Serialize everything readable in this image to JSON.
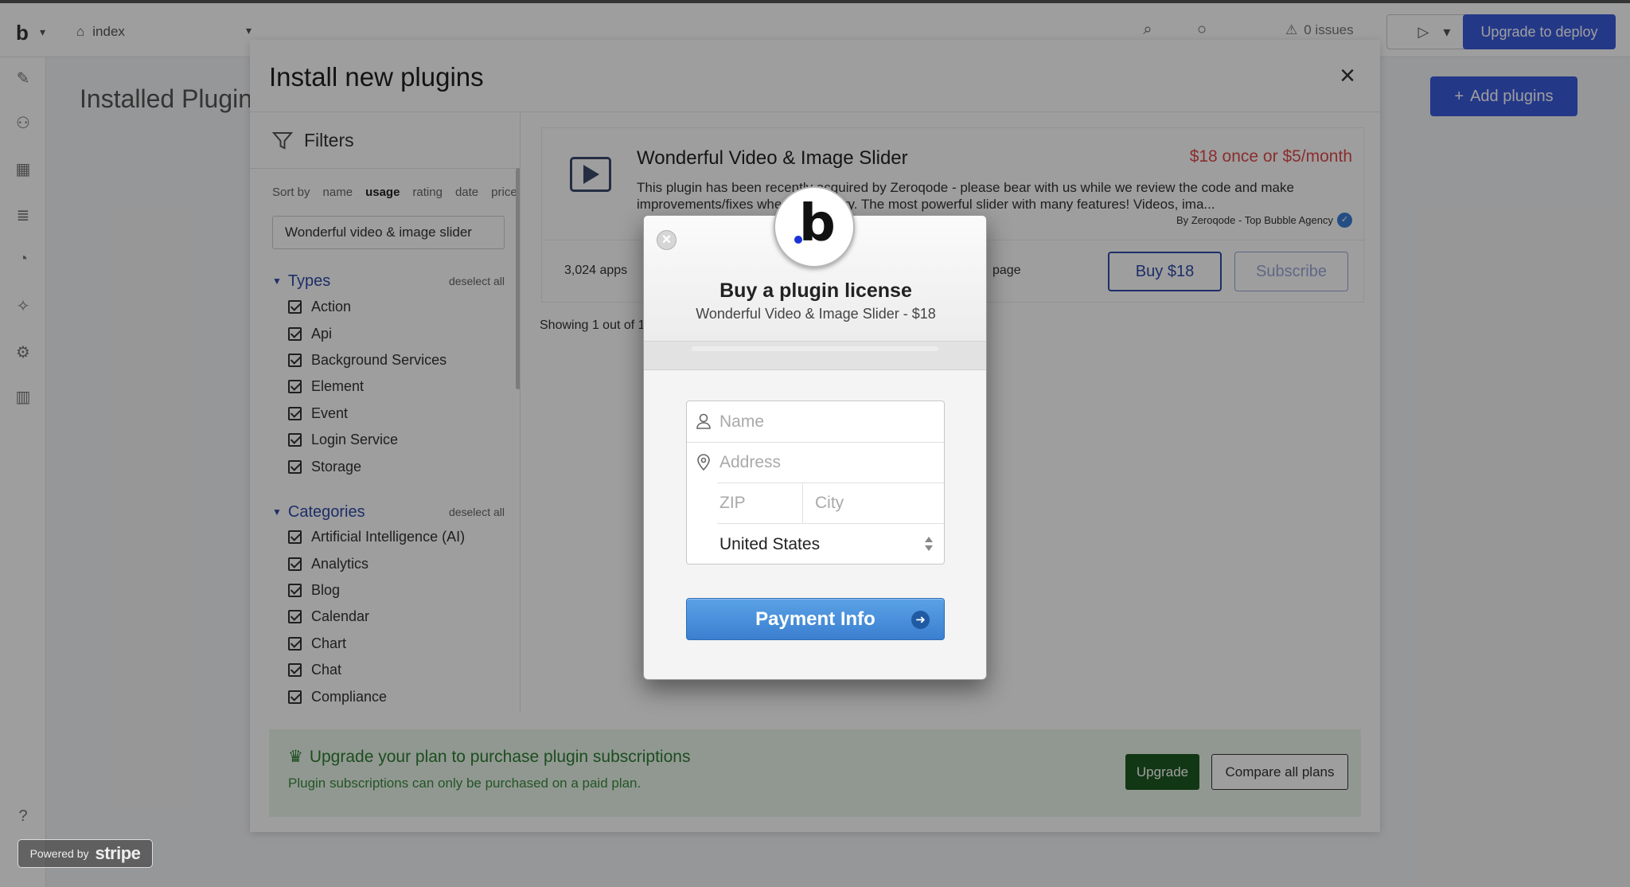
{
  "topbar": {
    "logo": "b",
    "page_name": "index",
    "issues": "0 issues",
    "deploy_label": "Upgrade to deploy"
  },
  "background": {
    "page_title": "Installed Plugins",
    "add_plugins_label": "Add plugins"
  },
  "plugin_modal": {
    "title": "Install new plugins",
    "filters": {
      "heading": "Filters",
      "sort_by_label": "Sort by",
      "sort_options": [
        "name",
        "usage",
        "rating",
        "date",
        "price"
      ],
      "active_sort": "usage",
      "search_value": "Wonderful video & image slider",
      "types": {
        "label": "Types",
        "deselect_label": "deselect all",
        "items": [
          "Action",
          "Api",
          "Background Services",
          "Element",
          "Event",
          "Login Service",
          "Storage"
        ]
      },
      "categories": {
        "label": "Categories",
        "deselect_label": "deselect all",
        "items": [
          "Artificial Intelligence (AI)",
          "Analytics",
          "Blog",
          "Calendar",
          "Chart",
          "Chat",
          "Compliance"
        ]
      }
    },
    "plugin": {
      "name": "Wonderful Video & Image Slider",
      "price": "$18 once or $5/month",
      "description": "This plugin has been recently acquired by Zeroqode - please bear with us while we review the code and make improvements/fixes when necessary. The most powerful slider with many features! Videos, ima...",
      "author": "By Zeroqode - Top Bubble Agency",
      "apps_count": "3,024 apps",
      "page_link": "page",
      "buy_label": "Buy $18",
      "subscribe_label": "Subscribe"
    },
    "showing_text": "Showing 1 out of 1",
    "upgrade_banner": {
      "title": "Upgrade your plan to purchase plugin subscriptions",
      "subtitle": "Plugin subscriptions can only be purchased on a paid plan.",
      "upgrade_label": "Upgrade",
      "compare_label": "Compare all plans"
    }
  },
  "checkout": {
    "title": "Buy a plugin license",
    "subtitle": "Wonderful Video & Image Slider - $18",
    "name_placeholder": "Name",
    "address_placeholder": "Address",
    "zip_placeholder": "ZIP",
    "city_placeholder": "City",
    "country_value": "United States",
    "pay_label": "Payment Info",
    "close_symbol": "×"
  },
  "stripe_badge": {
    "powered_by": "Powered by",
    "brand": "stripe"
  },
  "colors": {
    "accent": "#3b5bdb",
    "price": "#e04a4a",
    "pay_button": "#3b7fd0",
    "upgrade_green": "#1e5a23"
  }
}
